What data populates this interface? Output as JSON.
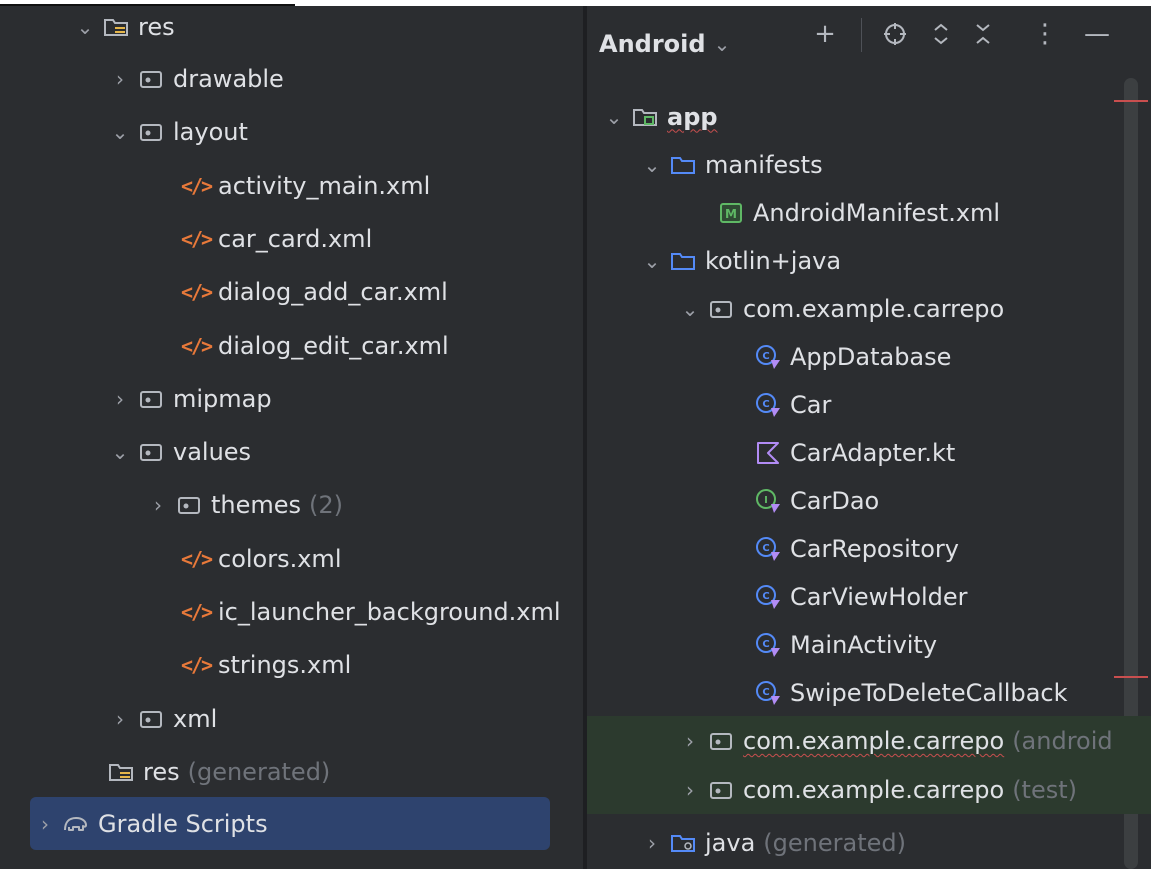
{
  "left_tree": {
    "res": "res",
    "drawable": "drawable",
    "layout": "layout",
    "activity_main": "activity_main.xml",
    "car_card": "car_card.xml",
    "dialog_add_car": "dialog_add_car.xml",
    "dialog_edit_car": "dialog_edit_car.xml",
    "mipmap": "mipmap",
    "values": "values",
    "themes": "themes",
    "themes_count": "(2)",
    "colors": "colors.xml",
    "ic_launcher_background": "ic_launcher_background.xml",
    "strings": "strings.xml",
    "xml": "xml",
    "res_generated": "res",
    "res_generated_suffix": "(generated)",
    "gradle_scripts": "Gradle Scripts"
  },
  "project_view": {
    "mode": "Android",
    "toolbar": {
      "add_icon": "plus-icon",
      "locate_icon": "crosshair-icon",
      "expand_icon": "expand-all-icon",
      "collapse_icon": "collapse-all-icon",
      "options_icon": "more-vertical-icon",
      "hide_icon": "minimize-icon"
    }
  },
  "right_tree": {
    "app": "app",
    "manifests": "manifests",
    "android_manifest": "AndroidManifest.xml",
    "kotlin_java": "kotlin+java",
    "package_main": "com.example.carrepo",
    "classes": [
      "AppDatabase",
      "Car",
      "CarAdapter.kt",
      "CarDao",
      "CarRepository",
      "CarViewHolder",
      "MainActivity",
      "SwipeToDeleteCallback"
    ],
    "package_android_test": "com.example.carrepo",
    "package_android_test_suffix": "(android",
    "package_test": "com.example.carrepo",
    "package_test_suffix": "(test)",
    "java_generated": "java",
    "java_generated_suffix": "(generated)"
  },
  "colors": {
    "background": "#2b2d30",
    "selection": "#2e436e",
    "test_highlight": "#2c3a2e",
    "xml_orange": "#e8793a",
    "folder_blue": "#548af7",
    "kotlin_purple": "#b28cf5",
    "manifest_green": "#5fb865",
    "muted_text": "#6f737a"
  }
}
